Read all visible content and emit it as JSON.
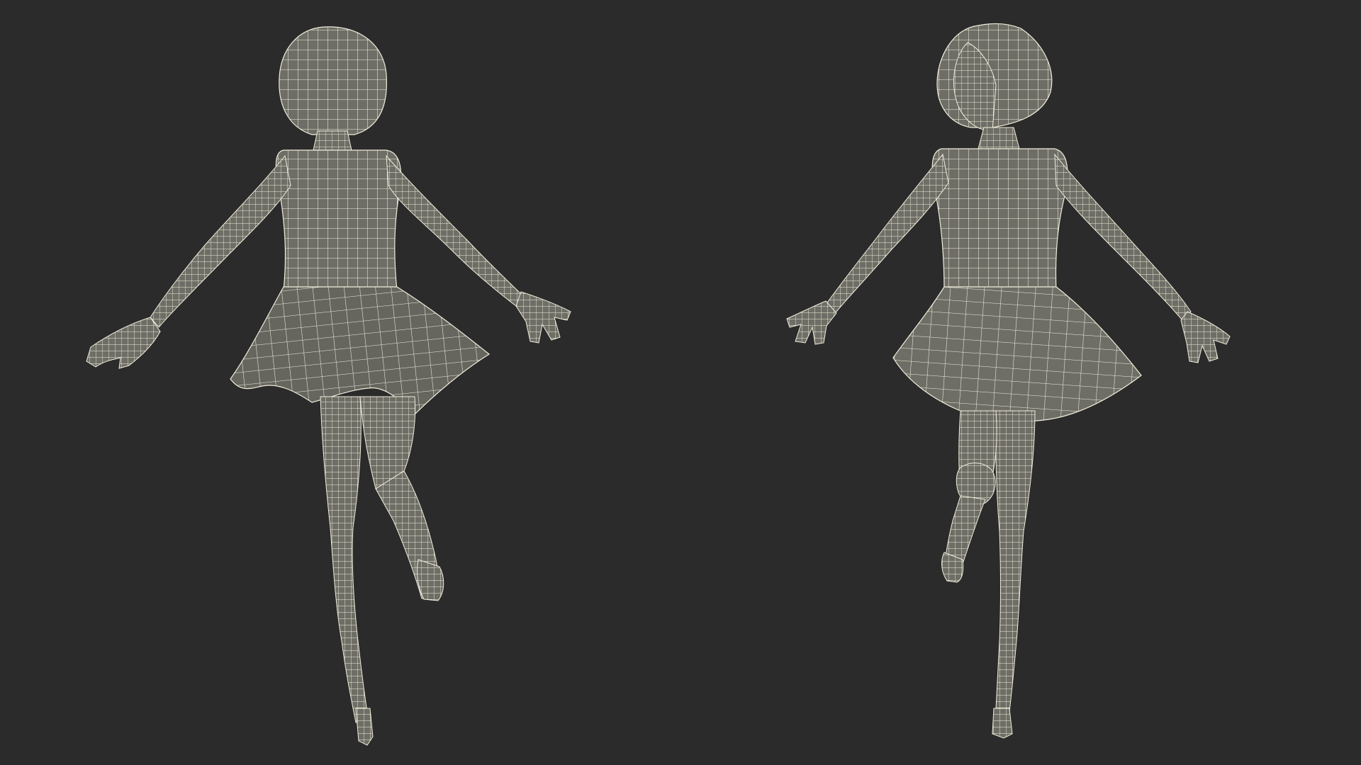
{
  "scene": {
    "background_color": "#2b2b2b",
    "mesh_fill_color": "#6e6e66",
    "mesh_shadow_color": "#55554f",
    "wire_color": "#f1eedc"
  },
  "figures": [
    {
      "view": "back",
      "pose": "arms-spread-left-knee-raised"
    },
    {
      "view": "front",
      "pose": "arms-spread-right-knee-raised"
    }
  ]
}
